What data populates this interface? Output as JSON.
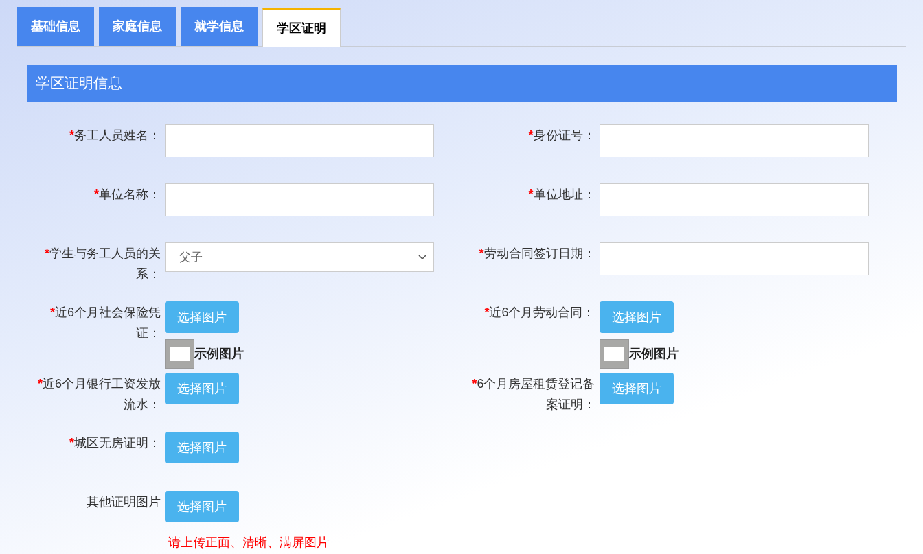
{
  "tabs": [
    {
      "label": "基础信息",
      "selected": false
    },
    {
      "label": "家庭信息",
      "selected": false
    },
    {
      "label": "就学信息",
      "selected": false
    },
    {
      "label": "学区证明",
      "selected": true
    }
  ],
  "section_title": "学区证明信息",
  "rows": [
    [
      {
        "kind": "text",
        "required_mark": "*",
        "label": "务工人员姓名："
      },
      {
        "kind": "text",
        "required_mark": "*",
        "label": "身份证号："
      }
    ],
    [
      {
        "kind": "text",
        "required_mark": "*",
        "label": "单位名称："
      },
      {
        "kind": "text",
        "required_mark": "*",
        "label": "单位地址："
      }
    ],
    [
      {
        "kind": "select",
        "required_mark": "*",
        "label": "学生与务工人员的关系：",
        "value": "父子"
      },
      {
        "kind": "text",
        "required_mark": "*",
        "label": "劳动合同签订日期："
      }
    ],
    [
      {
        "kind": "upload",
        "required_mark": "*",
        "label": "近6个月社会保险凭证：",
        "button": "选择图片",
        "sample": "示例图片"
      },
      {
        "kind": "upload",
        "required_mark": "*",
        "label": "近6个月劳动合同：",
        "button": "选择图片",
        "sample": "示例图片"
      }
    ],
    [
      {
        "kind": "upload",
        "required_mark": "*",
        "label": "近6个月银行工资发放流水：",
        "button": "选择图片"
      },
      {
        "kind": "upload",
        "required_mark": "*",
        "label": "6个月房屋租赁登记备案证明：",
        "button": "选择图片"
      }
    ],
    [
      {
        "kind": "upload",
        "required_mark": "*",
        "label": "城区无房证明：",
        "button": "选择图片"
      }
    ],
    [
      {
        "kind": "upload",
        "label": "其他证明图片",
        "button": "选择图片"
      }
    ]
  ],
  "note": "请上传正面、清晰、满屏图片"
}
